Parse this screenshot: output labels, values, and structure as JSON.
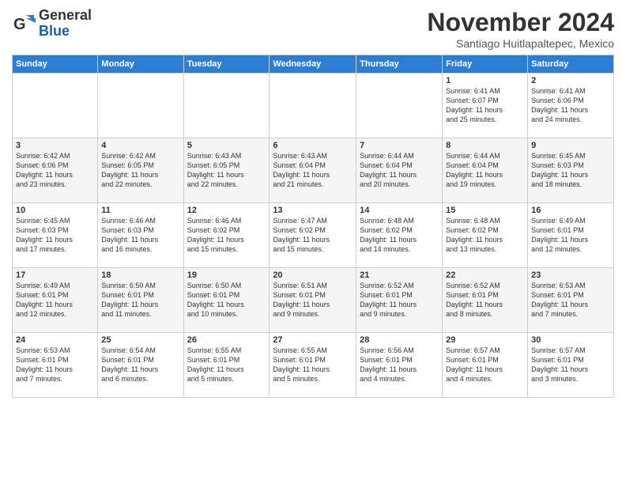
{
  "logo": {
    "text_general": "General",
    "text_blue": "Blue"
  },
  "header": {
    "month": "November 2024",
    "location": "Santiago Huitlapaltepec, Mexico"
  },
  "days_of_week": [
    "Sunday",
    "Monday",
    "Tuesday",
    "Wednesday",
    "Thursday",
    "Friday",
    "Saturday"
  ],
  "weeks": [
    [
      {
        "day": "",
        "info": ""
      },
      {
        "day": "",
        "info": ""
      },
      {
        "day": "",
        "info": ""
      },
      {
        "day": "",
        "info": ""
      },
      {
        "day": "",
        "info": ""
      },
      {
        "day": "1",
        "info": "Sunrise: 6:41 AM\nSunset: 6:07 PM\nDaylight: 11 hours\nand 25 minutes."
      },
      {
        "day": "2",
        "info": "Sunrise: 6:41 AM\nSunset: 6:06 PM\nDaylight: 11 hours\nand 24 minutes."
      }
    ],
    [
      {
        "day": "3",
        "info": "Sunrise: 6:42 AM\nSunset: 6:06 PM\nDaylight: 11 hours\nand 23 minutes."
      },
      {
        "day": "4",
        "info": "Sunrise: 6:42 AM\nSunset: 6:05 PM\nDaylight: 11 hours\nand 22 minutes."
      },
      {
        "day": "5",
        "info": "Sunrise: 6:43 AM\nSunset: 6:05 PM\nDaylight: 11 hours\nand 22 minutes."
      },
      {
        "day": "6",
        "info": "Sunrise: 6:43 AM\nSunset: 6:04 PM\nDaylight: 11 hours\nand 21 minutes."
      },
      {
        "day": "7",
        "info": "Sunrise: 6:44 AM\nSunset: 6:04 PM\nDaylight: 11 hours\nand 20 minutes."
      },
      {
        "day": "8",
        "info": "Sunrise: 6:44 AM\nSunset: 6:04 PM\nDaylight: 11 hours\nand 19 minutes."
      },
      {
        "day": "9",
        "info": "Sunrise: 6:45 AM\nSunset: 6:03 PM\nDaylight: 11 hours\nand 18 minutes."
      }
    ],
    [
      {
        "day": "10",
        "info": "Sunrise: 6:45 AM\nSunset: 6:03 PM\nDaylight: 11 hours\nand 17 minutes."
      },
      {
        "day": "11",
        "info": "Sunrise: 6:46 AM\nSunset: 6:03 PM\nDaylight: 11 hours\nand 16 minutes."
      },
      {
        "day": "12",
        "info": "Sunrise: 6:46 AM\nSunset: 6:02 PM\nDaylight: 11 hours\nand 15 minutes."
      },
      {
        "day": "13",
        "info": "Sunrise: 6:47 AM\nSunset: 6:02 PM\nDaylight: 11 hours\nand 15 minutes."
      },
      {
        "day": "14",
        "info": "Sunrise: 6:48 AM\nSunset: 6:02 PM\nDaylight: 11 hours\nand 14 minutes."
      },
      {
        "day": "15",
        "info": "Sunrise: 6:48 AM\nSunset: 6:02 PM\nDaylight: 11 hours\nand 13 minutes."
      },
      {
        "day": "16",
        "info": "Sunrise: 6:49 AM\nSunset: 6:01 PM\nDaylight: 11 hours\nand 12 minutes."
      }
    ],
    [
      {
        "day": "17",
        "info": "Sunrise: 6:49 AM\nSunset: 6:01 PM\nDaylight: 11 hours\nand 12 minutes."
      },
      {
        "day": "18",
        "info": "Sunrise: 6:50 AM\nSunset: 6:01 PM\nDaylight: 11 hours\nand 11 minutes."
      },
      {
        "day": "19",
        "info": "Sunrise: 6:50 AM\nSunset: 6:01 PM\nDaylight: 11 hours\nand 10 minutes."
      },
      {
        "day": "20",
        "info": "Sunrise: 6:51 AM\nSunset: 6:01 PM\nDaylight: 11 hours\nand 9 minutes."
      },
      {
        "day": "21",
        "info": "Sunrise: 6:52 AM\nSunset: 6:01 PM\nDaylight: 11 hours\nand 9 minutes."
      },
      {
        "day": "22",
        "info": "Sunrise: 6:52 AM\nSunset: 6:01 PM\nDaylight: 11 hours\nand 8 minutes."
      },
      {
        "day": "23",
        "info": "Sunrise: 6:53 AM\nSunset: 6:01 PM\nDaylight: 11 hours\nand 7 minutes."
      }
    ],
    [
      {
        "day": "24",
        "info": "Sunrise: 6:53 AM\nSunset: 6:01 PM\nDaylight: 11 hours\nand 7 minutes."
      },
      {
        "day": "25",
        "info": "Sunrise: 6:54 AM\nSunset: 6:01 PM\nDaylight: 11 hours\nand 6 minutes."
      },
      {
        "day": "26",
        "info": "Sunrise: 6:55 AM\nSunset: 6:01 PM\nDaylight: 11 hours\nand 5 minutes."
      },
      {
        "day": "27",
        "info": "Sunrise: 6:55 AM\nSunset: 6:01 PM\nDaylight: 11 hours\nand 5 minutes."
      },
      {
        "day": "28",
        "info": "Sunrise: 6:56 AM\nSunset: 6:01 PM\nDaylight: 11 hours\nand 4 minutes."
      },
      {
        "day": "29",
        "info": "Sunrise: 6:57 AM\nSunset: 6:01 PM\nDaylight: 11 hours\nand 4 minutes."
      },
      {
        "day": "30",
        "info": "Sunrise: 6:57 AM\nSunset: 6:01 PM\nDaylight: 11 hours\nand 3 minutes."
      }
    ]
  ]
}
